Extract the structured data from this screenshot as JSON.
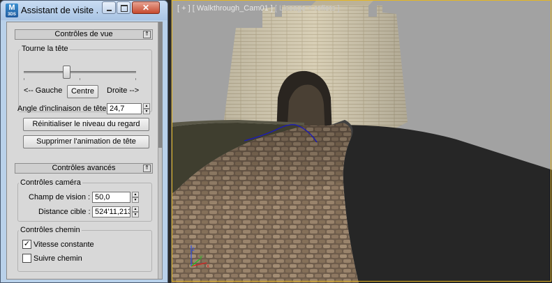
{
  "window": {
    "title": "Assistant de visite ...",
    "icon_text": "M",
    "icon_subtext": "3DS",
    "close_glyph": "✕"
  },
  "view_controls": {
    "header": "Contrôles de vue",
    "collapse_glyph": "⇑",
    "group_label": "Tourne la tête",
    "left_label": "<-- Gauche",
    "center_button": "Centre",
    "right_label": "Droite -->",
    "slider_value": 0.38,
    "tilt_label": "Angle d'inclinaison de tête",
    "tilt_value": "24,7",
    "reset_button": "Réinitialiser le niveau du regard",
    "delete_button": "Supprimer l'animation de tête"
  },
  "advanced_controls": {
    "header": "Contrôles avancés",
    "collapse_glyph": "⇑",
    "camera_group": "Contrôles caméra",
    "fov_label": "Champ de vision :",
    "fov_value": "50,0",
    "target_label": "Distance cible :",
    "target_value": "524'11,213\"",
    "path_group": "Contrôles chemin",
    "constant_speed_label": "Vitesse constante",
    "constant_speed_checked": true,
    "check_glyph": "✓",
    "follow_path_label": "Suivre chemin",
    "follow_path_checked": false
  },
  "spinner_glyphs": {
    "up": "▲",
    "down": "▼"
  },
  "viewport": {
    "label_main": "[ + ] [ Walkthrough_Cam01 ]",
    "label_dim": "[ Lissage + reflets ]",
    "border_color": "#e4b623",
    "axis_colors": {
      "x": "#d82020",
      "y": "#20c020",
      "z": "#3050e0"
    }
  }
}
